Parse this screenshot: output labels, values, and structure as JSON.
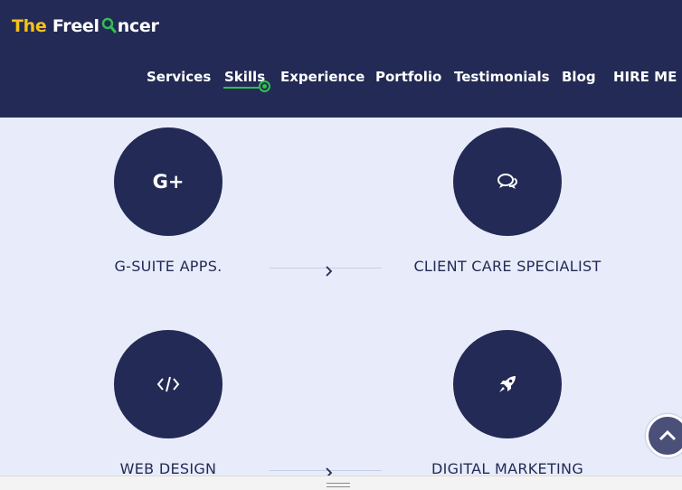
{
  "brand": {
    "part1": "The",
    "part2": "Freel",
    "part3": "ncer"
  },
  "nav": [
    {
      "label": "Services"
    },
    {
      "label": "Skills",
      "active": true
    },
    {
      "label": "Experience"
    },
    {
      "label": "Portfolio"
    },
    {
      "label": "Testimonials"
    },
    {
      "label": "Blog"
    },
    {
      "label": "HIRE ME"
    }
  ],
  "skills": [
    {
      "label": "G-SUITE APPS.",
      "icon": "google-plus-icon",
      "icon_text": "G+"
    },
    {
      "label": "CLIENT CARE SPECIALIST",
      "icon": "chat-bubbles-icon"
    },
    {
      "label": "WEB DESIGN",
      "icon": "code-icon"
    },
    {
      "label": "DIGITAL MARKETING",
      "icon": "rocket-icon"
    }
  ],
  "colors": {
    "navy": "#232a55",
    "accent_green": "#2fc14d",
    "logo_yellow": "#f6c21a",
    "page_bg": "#e8ecfa"
  }
}
